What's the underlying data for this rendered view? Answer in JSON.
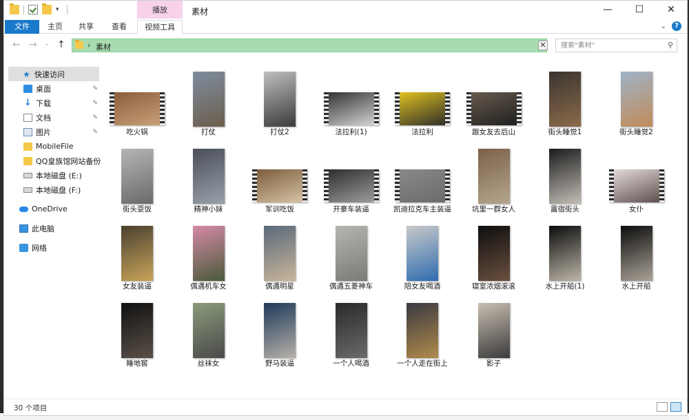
{
  "window": {
    "title": "素材",
    "context_tab": "播放",
    "controls": {
      "minimize": "—",
      "maximize": "☐",
      "close": "✕"
    }
  },
  "ribbon": {
    "tabs": [
      "文件",
      "主页",
      "共享",
      "查看",
      "视频工具"
    ],
    "collapse_icon": "chevron-down-icon",
    "help": "?"
  },
  "address": {
    "crumb_sep": "›",
    "path": "素材",
    "clear": "✕",
    "search_placeholder": "搜索\"素材\""
  },
  "nav": {
    "back": "←",
    "forward": "→",
    "recent": "⌄",
    "up": "↑",
    "items": [
      {
        "label": "快速访问",
        "icon": "star-icon"
      },
      {
        "label": "桌面",
        "icon": "desktop-icon",
        "pinned": true
      },
      {
        "label": "下载",
        "icon": "download-icon",
        "pinned": true
      },
      {
        "label": "文档",
        "icon": "document-icon",
        "pinned": true
      },
      {
        "label": "图片",
        "icon": "pictures-icon",
        "pinned": true
      },
      {
        "label": "MobileFile",
        "icon": "folder-icon"
      },
      {
        "label": "QQ皇族馆网站备份",
        "icon": "folder-icon"
      },
      {
        "label": "本地磁盘 (E:)",
        "icon": "drive-icon"
      },
      {
        "label": "本地磁盘 (F:)",
        "icon": "drive-icon"
      },
      {
        "label": "OneDrive",
        "icon": "cloud-icon"
      },
      {
        "label": "此电脑",
        "icon": "computer-icon"
      },
      {
        "label": "网络",
        "icon": "network-icon"
      }
    ],
    "pin_glyph": "📌"
  },
  "files": [
    {
      "name": "吃火锅",
      "kind": "film",
      "colors": [
        "#8a5a3a",
        "#c9a27a"
      ]
    },
    {
      "name": "打仗",
      "kind": "portrait",
      "colors": [
        "#7f8d9f",
        "#6b5e4c"
      ]
    },
    {
      "name": "打仗2",
      "kind": "portrait",
      "colors": [
        "#bfbfbf",
        "#3a3a3a"
      ]
    },
    {
      "name": "法拉利(1)",
      "kind": "film",
      "colors": [
        "#2e2e2e",
        "#d8d8d8"
      ]
    },
    {
      "name": "法拉利",
      "kind": "film",
      "colors": [
        "#e5c51f",
        "#2a2a2a"
      ]
    },
    {
      "name": "跟女友去后山",
      "kind": "film",
      "colors": [
        "#6a5c4f",
        "#1e1e1e"
      ]
    },
    {
      "name": "街头睡觉1",
      "kind": "portrait",
      "colors": [
        "#3a3530",
        "#8b6a4a"
      ]
    },
    {
      "name": "街头睡觉2",
      "kind": "portrait",
      "colors": [
        "#9fb3c7",
        "#c08b5a"
      ]
    },
    {
      "name": "街头耍饭",
      "kind": "portrait",
      "colors": [
        "#b5b5b5",
        "#6a6a6a"
      ]
    },
    {
      "name": "精神小妹",
      "kind": "portrait",
      "colors": [
        "#4a4f5a",
        "#9aa0aa"
      ]
    },
    {
      "name": "军训吃饭",
      "kind": "film",
      "colors": [
        "#7a5a3a",
        "#d8c6a8"
      ]
    },
    {
      "name": "开豪车装逼",
      "kind": "film",
      "colors": [
        "#2a2a2a",
        "#a0a0a0"
      ]
    },
    {
      "name": "凯迪拉克车主装逼",
      "kind": "film",
      "colors": [
        "#8a8a8a",
        "#6a6a6a"
      ]
    },
    {
      "name": "坑里一群女人",
      "kind": "portrait",
      "colors": [
        "#7a6248",
        "#b5a58d"
      ]
    },
    {
      "name": "露宿街头",
      "kind": "portrait",
      "colors": [
        "#1c1c1c",
        "#c2bdb6"
      ]
    },
    {
      "name": "女仆",
      "kind": "film",
      "colors": [
        "#e8e0dc",
        "#5a4a4a"
      ]
    },
    {
      "name": "女友装逼",
      "kind": "portrait",
      "colors": [
        "#4a4030",
        "#c9a45a"
      ]
    },
    {
      "name": "偶遇机车女",
      "kind": "portrait",
      "colors": [
        "#d58aa6",
        "#4a5a3a"
      ]
    },
    {
      "name": "偶遇明星",
      "kind": "portrait",
      "colors": [
        "#5a6a7a",
        "#c8b59a"
      ]
    },
    {
      "name": "偶遇五菱神车",
      "kind": "portrait",
      "colors": [
        "#b5b5b0",
        "#7a7a78"
      ]
    },
    {
      "name": "陪女友喝酒",
      "kind": "portrait",
      "colors": [
        "#c9c9c9",
        "#2f6db0"
      ]
    },
    {
      "name": "寝室浓烟滚滚",
      "kind": "portrait",
      "colors": [
        "#0e0e0e",
        "#6a5040"
      ]
    },
    {
      "name": "水上开船(1)",
      "kind": "portrait",
      "colors": [
        "#0c0c0c",
        "#bdb6a8"
      ]
    },
    {
      "name": "水上开船",
      "kind": "portrait",
      "colors": [
        "#0c0c0c",
        "#aaa398"
      ]
    },
    {
      "name": "睡地窖",
      "kind": "portrait",
      "colors": [
        "#111111",
        "#5a5048"
      ]
    },
    {
      "name": "丝袜女",
      "kind": "portrait",
      "colors": [
        "#8a9a7a",
        "#4a4a4a"
      ]
    },
    {
      "name": "野马装逼",
      "kind": "portrait",
      "colors": [
        "#1f3a5a",
        "#b5b0a8"
      ]
    },
    {
      "name": "一个人喝酒",
      "kind": "portrait",
      "colors": [
        "#2a2a2a",
        "#6a6a6a"
      ]
    },
    {
      "name": "一个人走在街上",
      "kind": "portrait",
      "colors": [
        "#3a3a42",
        "#b08a4a"
      ]
    },
    {
      "name": "影子",
      "kind": "portrait",
      "colors": [
        "#c9bfb2",
        "#3a3a3a"
      ]
    }
  ],
  "status": {
    "count": "30 个项目",
    "views": [
      "details-view-icon",
      "large-icons-view-icon"
    ]
  }
}
